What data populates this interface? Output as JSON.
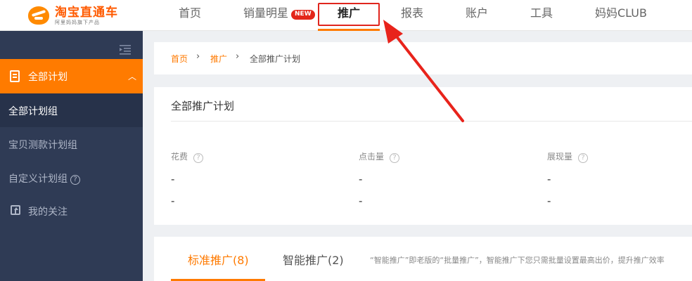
{
  "logo": {
    "title": "淘宝直通车",
    "subtitle": "阿里妈妈旗下产品"
  },
  "nav": {
    "items": [
      {
        "label": "首页"
      },
      {
        "label": "销量明星",
        "badge": "NEW"
      },
      {
        "label": "推广",
        "active": true
      },
      {
        "label": "报表"
      },
      {
        "label": "账户"
      },
      {
        "label": "工具"
      },
      {
        "label": "妈妈CLUB"
      }
    ]
  },
  "sidebar": {
    "section": {
      "label": "全部计划",
      "icon": "document-icon",
      "expanded_icon": "chevron-up-icon"
    },
    "items": [
      {
        "label": "全部计划组",
        "selected": true
      },
      {
        "label": "宝贝测款计划组"
      },
      {
        "label": "自定义计划组",
        "help_icon": "?"
      }
    ],
    "follow": {
      "label": "我的关注",
      "icon": "upload-icon"
    }
  },
  "breadcrumb": {
    "items": [
      "首页",
      "推广",
      "全部推广计划"
    ],
    "separator": "›"
  },
  "summary": {
    "title": "全部推广计划",
    "metrics": [
      {
        "label": "花费",
        "help": "?",
        "value": "-",
        "compare": "-"
      },
      {
        "label": "点击量",
        "help": "?",
        "value": "-",
        "compare": "-"
      },
      {
        "label": "展现量",
        "help": "?",
        "value": "-",
        "compare": "-"
      }
    ]
  },
  "tabs": {
    "items": [
      {
        "label": "标准推广(8)",
        "active": true
      },
      {
        "label": "智能推广(2)"
      }
    ],
    "note": "“智能推广”即老版的“批量推广”，智能推广下您只需批量设置最高出价，提升推广效率"
  },
  "colors": {
    "accent": "#ff7a00",
    "highlight_box": "#e0251d",
    "sidebar_bg": "#2f3b55",
    "badge": "#e3261a"
  }
}
